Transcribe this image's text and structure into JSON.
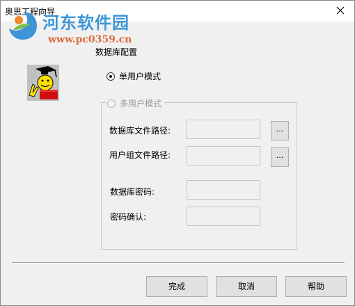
{
  "window": {
    "title": "奥思工程向导",
    "close_label": "×"
  },
  "watermark": {
    "site_name": "河东软件园",
    "url": "www.pc0359.cn"
  },
  "page_title": "数据库配置",
  "mode": {
    "single_label": "单用户模式",
    "single_selected": true,
    "multi_label": "多用户模式",
    "multi_enabled": false
  },
  "form": {
    "db_path_label": "数据库文件路径:",
    "db_path_value": "",
    "db_browse_label": "...",
    "group_path_label": "用户组文件路径:",
    "group_path_value": "",
    "group_browse_label": "...",
    "db_password_label": "数据库密码:",
    "confirm_label": "密码确认:"
  },
  "buttons": {
    "finish": "完成",
    "cancel": "取消",
    "help": "帮助"
  }
}
